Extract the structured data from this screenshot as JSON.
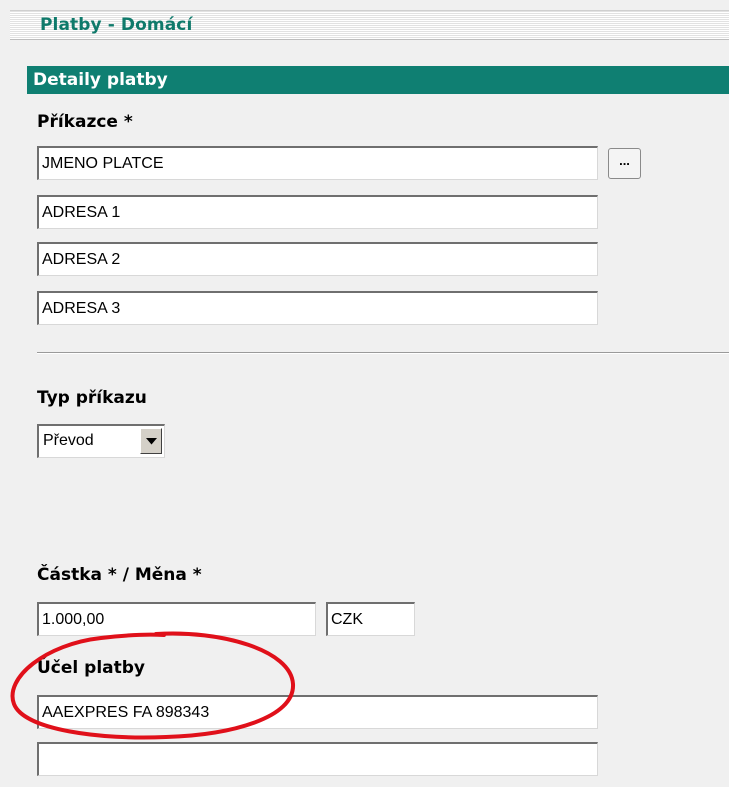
{
  "window": {
    "title": "Platby - Domácí"
  },
  "panel": {
    "header": "Detaily platby"
  },
  "payer": {
    "label": "Příkazce *",
    "name": "JMENO PLATCE",
    "address1": "ADRESA 1",
    "address2": "ADRESA 2",
    "address3": "ADRESA 3",
    "lookup_button_label": "..."
  },
  "order_type": {
    "label": "Typ příkazu",
    "selected": "Převod"
  },
  "amount": {
    "label": "Částka * / Měna *",
    "value": "1.000,00",
    "currency": "CZK"
  },
  "purpose": {
    "label": "Účel platby",
    "line1": "AAEXPRES FA 898343",
    "line2": ""
  },
  "colors": {
    "accent": "#0f7f72",
    "annotation": "#e0101a"
  },
  "icons": [
    "dropdown-arrow-icon"
  ]
}
